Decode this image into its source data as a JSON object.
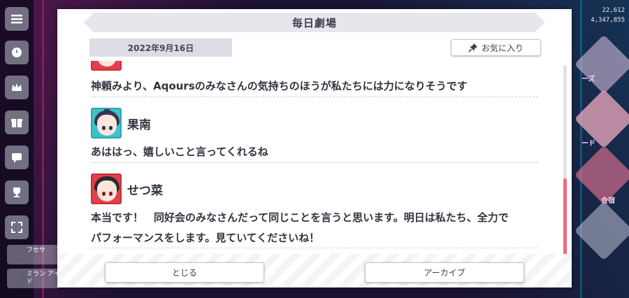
{
  "background": {
    "currency_top": "22,612",
    "currency_bottom": "4,347,855",
    "menu_labels": [
      "フセサ",
      "ミラン アイド"
    ],
    "right_labels": [
      "ーズ",
      "ード",
      "合宿"
    ],
    "colors": {
      "accent_pink": "#f06a80",
      "accent_cyan": "#3ec1c8"
    }
  },
  "modal": {
    "title": "毎日劇場",
    "date": "2022年9月16日",
    "favorite_button": {
      "label": "お気に入り",
      "icon": "pin-icon"
    },
    "dialogue": [
      {
        "speaker": "",
        "text": "神頼みより、Aqoursのみなさんの気持ちのほうが私たちには力になりそうです"
      },
      {
        "speaker": "果南",
        "avatar": "kanan-avatar",
        "text": "あははっ、嬉しいこと言ってくれるね"
      },
      {
        "speaker": "せつ菜",
        "avatar": "setsuna-avatar",
        "text_lines": [
          "本当です！　同好会のみなさんだって同じことを言うと思います。明日は私たち、全力で",
          "パフォーマンスをします。見ていてくださいね！"
        ]
      }
    ],
    "scroll": {
      "position_fraction": 0.6
    },
    "footer": {
      "close_label": "とじる",
      "archive_label": "アーカイブ"
    }
  }
}
